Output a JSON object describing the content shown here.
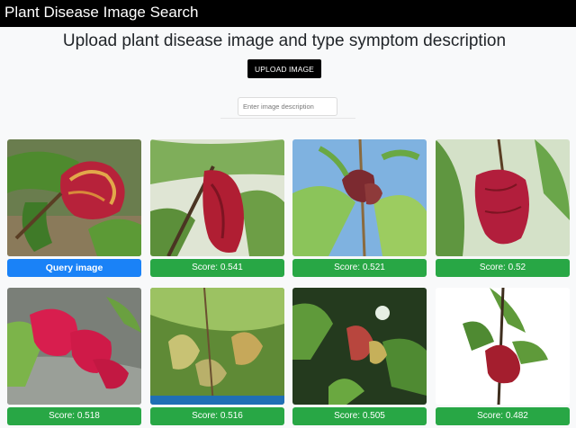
{
  "navbar": {
    "brand": "Plant Disease Image Search"
  },
  "main": {
    "heading": "Upload plant disease image and type symptom description",
    "upload_button": "UPLOAD IMAGE",
    "description_placeholder": "Enter image description"
  },
  "results": [
    {
      "label": "Query image",
      "kind": "query"
    },
    {
      "label": "Score: 0.541",
      "kind": "score"
    },
    {
      "label": "Score: 0.521",
      "kind": "score"
    },
    {
      "label": "Score: 0.52",
      "kind": "score"
    },
    {
      "label": "Score: 0.518",
      "kind": "score"
    },
    {
      "label": "Score: 0.516",
      "kind": "score"
    },
    {
      "label": "Score: 0.505",
      "kind": "score"
    },
    {
      "label": "Score: 0.482",
      "kind": "score"
    }
  ],
  "colors": {
    "query_label": "#1a82f7",
    "score_label": "#28a745",
    "navbar": "#000000",
    "leaf_curl_red": "#b7223a"
  }
}
